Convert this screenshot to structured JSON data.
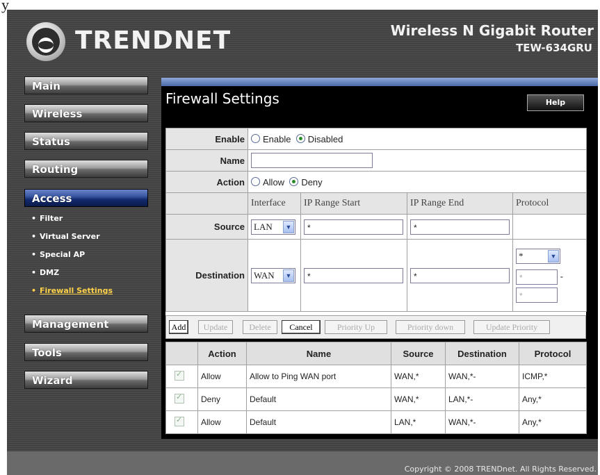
{
  "stray_text": "y",
  "header": {
    "brand": "TRENDNET",
    "product_name": "Wireless N Gigabit Router",
    "product_model": "TEW-634GRU"
  },
  "nav": {
    "main": "Main",
    "wireless": "Wireless",
    "status": "Status",
    "routing": "Routing",
    "access": "Access",
    "access_items": [
      "Filter",
      "Virtual Server",
      "Special AP",
      "DMZ",
      "Firewall Settings"
    ],
    "management": "Management",
    "tools": "Tools",
    "wizard": "Wizard"
  },
  "page": {
    "title": "Firewall Settings",
    "help_label": "Help"
  },
  "form": {
    "enable_label": "Enable",
    "enable_option": "Enable",
    "disabled_option": "Disabled",
    "name_label": "Name",
    "name_value": "",
    "action_label": "Action",
    "allow_option": "Allow",
    "deny_option": "Deny",
    "col_interface": "Interface",
    "col_ip_start": "IP Range Start",
    "col_ip_end": "IP Range End",
    "col_protocol": "Protocol",
    "source_label": "Source",
    "source_interface": "LAN",
    "source_ip_start": "*",
    "source_ip_end": "*",
    "destination_label": "Destination",
    "dest_interface": "WAN",
    "dest_ip_start": "*",
    "dest_ip_end": "*",
    "dest_protocol": "*",
    "port_start_placeholder": "*",
    "port_sep": "-",
    "port_end_placeholder": "*"
  },
  "buttons": {
    "add": "Add",
    "update": "Update",
    "delete": "Delete",
    "cancel": "Cancel",
    "priority_up": "Priority Up",
    "priority_down": "Priority down",
    "update_priority": "Update Priority"
  },
  "rules": {
    "headers": [
      "Action",
      "Name",
      "Source",
      "Destination",
      "Protocol"
    ],
    "rows": [
      {
        "action": "Allow",
        "name": "Allow to Ping WAN port",
        "source": "WAN,*",
        "destination": "WAN,*-",
        "protocol": "ICMP,*"
      },
      {
        "action": "Deny",
        "name": "Default",
        "source": "WAN,*",
        "destination": "LAN,*-",
        "protocol": "Any,*"
      },
      {
        "action": "Allow",
        "name": "Default",
        "source": "LAN,*",
        "destination": "WAN,*-",
        "protocol": "Any,*"
      }
    ]
  },
  "footer": {
    "copyright": "Copyright © 2008 TRENDnet. All Rights Reserved."
  }
}
